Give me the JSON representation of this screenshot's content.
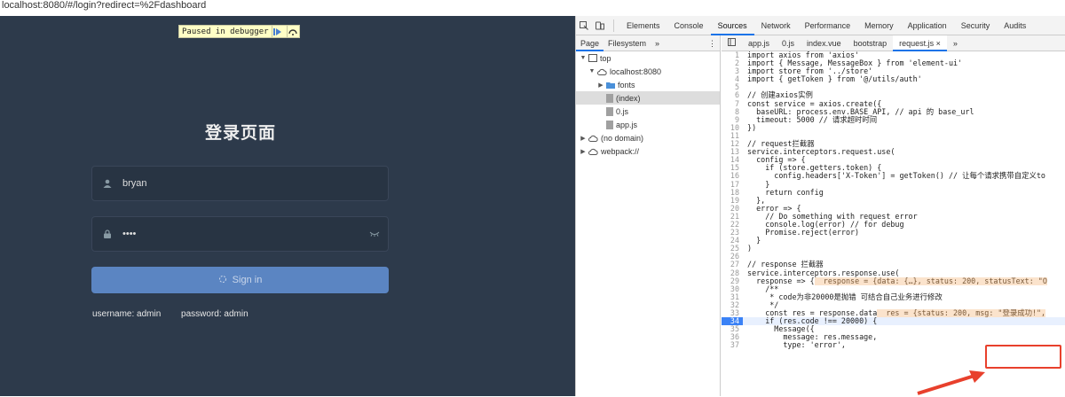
{
  "url": "localhost:8080/#/login?redirect=%2Fdashboard",
  "debugger": {
    "label": "Paused in debugger"
  },
  "login": {
    "title": "登录页面",
    "username_value": "bryan",
    "password_value": "••••",
    "signin_label": "Sign in",
    "tip_username": "username: admin",
    "tip_password": "password: admin"
  },
  "devtools": {
    "tabs": [
      "Elements",
      "Console",
      "Sources",
      "Network",
      "Performance",
      "Memory",
      "Application",
      "Security",
      "Audits"
    ],
    "active_tab": "Sources",
    "nav_tabs": [
      "Page",
      "Filesystem",
      "»"
    ],
    "tree": [
      {
        "label": "top",
        "depth": 0,
        "icon": "frame-icon",
        "tri": "▼"
      },
      {
        "label": "localhost:8080",
        "depth": 1,
        "icon": "cloud-icon",
        "tri": "▼"
      },
      {
        "label": "fonts",
        "depth": 2,
        "icon": "folder-icon",
        "tri": "▶"
      },
      {
        "label": "(index)",
        "depth": 2,
        "icon": "file-icon",
        "tri": "",
        "selected": true
      },
      {
        "label": "0.js",
        "depth": 2,
        "icon": "file-icon",
        "tri": ""
      },
      {
        "label": "app.js",
        "depth": 2,
        "icon": "file-icon",
        "tri": ""
      },
      {
        "label": "(no domain)",
        "depth": 0,
        "icon": "cloud-icon",
        "tri": "▶"
      },
      {
        "label": "webpack://",
        "depth": 0,
        "icon": "cloud-icon",
        "tri": "▶"
      }
    ],
    "file_tabs": [
      "app.js",
      "0.js",
      "index.vue",
      "bootstrap",
      "request.js ×",
      "»"
    ],
    "active_file": "request.js ×",
    "current_line": 34,
    "code": [
      "import axios from 'axios'",
      "import { Message, MessageBox } from 'element-ui'",
      "import store from '../store'",
      "import { getToken } from '@/utils/auth'",
      "",
      "// 创建axios实例",
      "const service = axios.create({",
      "  baseURL: process.env.BASE_API, // api 的 base_url",
      "  timeout: 5000 // 请求超时时间",
      "})",
      "",
      "// request拦截器",
      "service.interceptors.request.use(",
      "  config => {",
      "    if (store.getters.token) {",
      "      config.headers['X-Token'] = getToken() // 让每个请求携带自定义to",
      "    }",
      "    return config",
      "  },",
      "  error => {",
      "    // Do something with request error",
      "    console.log(error) // for debug",
      "    Promise.reject(error)",
      "  }",
      ")",
      "",
      "// response 拦截器",
      "service.interceptors.response.use(",
      "  response => {",
      "    /**",
      "     * code为非20000是抛错 可结合自己业务进行修改",
      "     */",
      "    const res = response.data",
      "    if (res.code !== 20000) {",
      "      Message({",
      "        message: res.message,",
      "        type: 'error',"
    ],
    "inline_values": [
      {
        "line": 29,
        "text": "response = {data: {…}, status: 200, statusText: \"O"
      },
      {
        "line": 33,
        "text": "res = {status: 200, msg: \"登录成功!\","
      }
    ]
  }
}
